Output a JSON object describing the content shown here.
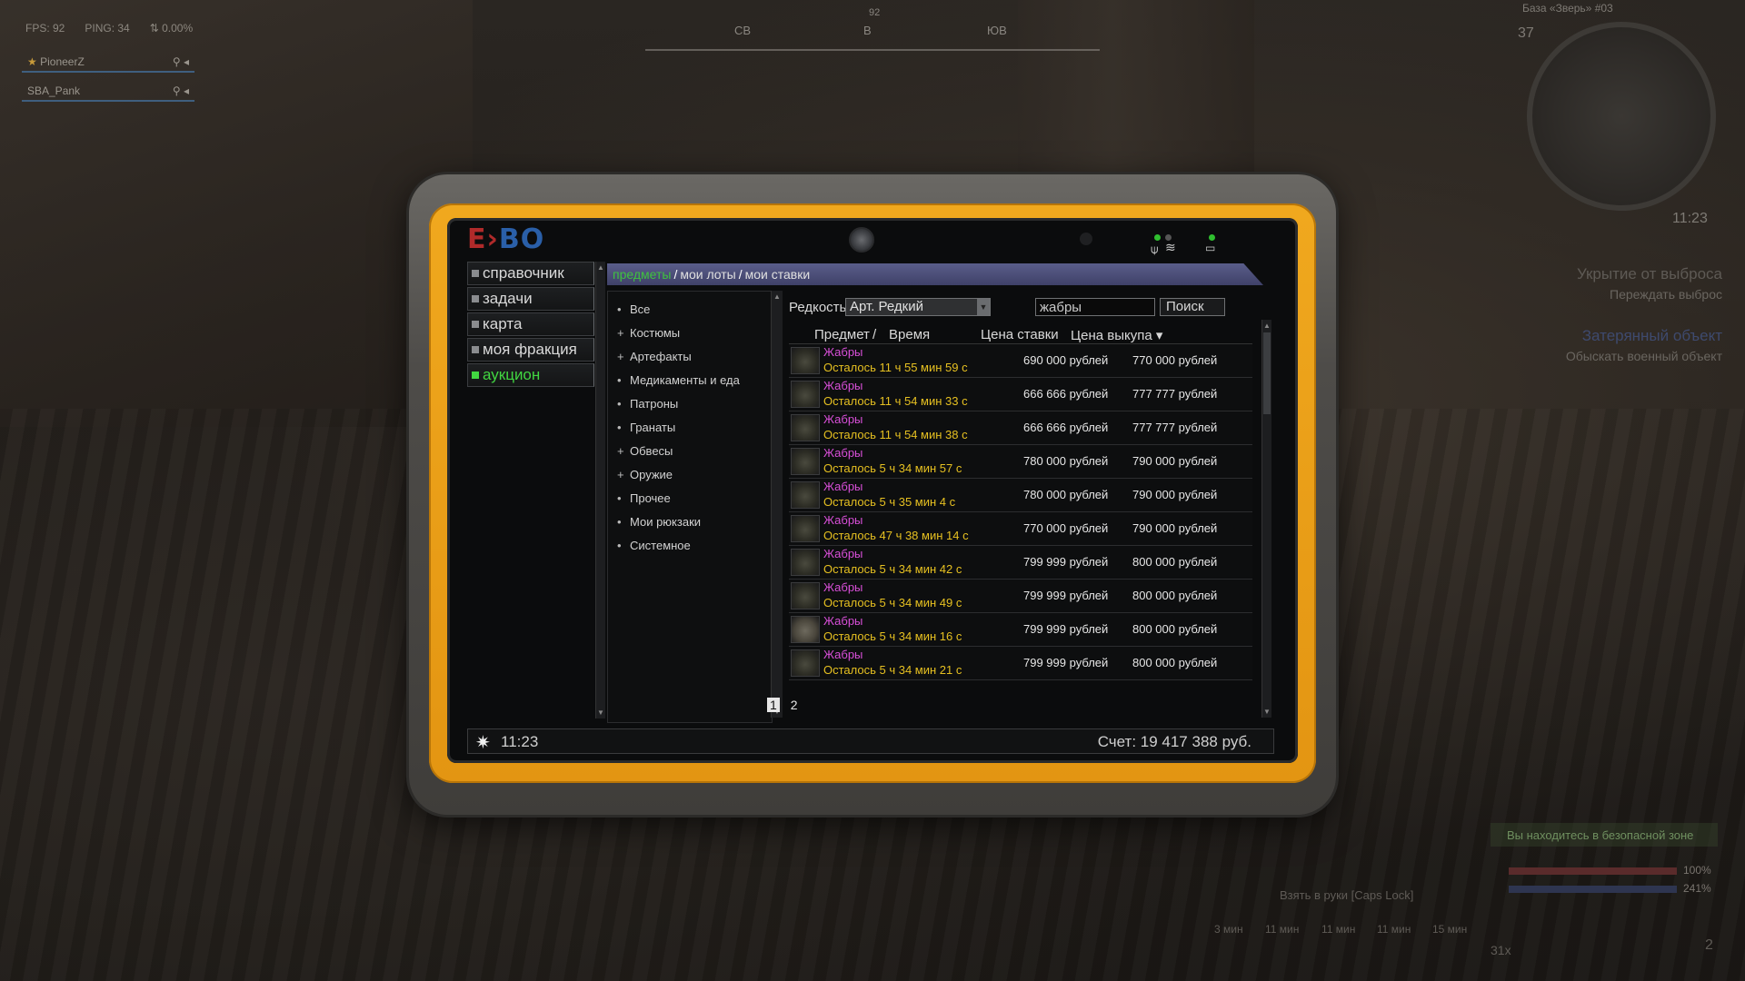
{
  "hud": {
    "fps": "FPS: 92",
    "ping": "PING: 34",
    "loss": "0.00%",
    "party": [
      {
        "name": "PioneerZ"
      },
      {
        "name": "SBA_Pank"
      }
    ],
    "compass": {
      "heading": "92",
      "labels": [
        "СВ",
        "В",
        "ЮВ"
      ]
    },
    "minimap": {
      "title": "База «Зверь» #03",
      "level": "37",
      "time": "11:23"
    },
    "quests": [
      {
        "title": "Укрытие от выброса",
        "sub": "Переждать выброс"
      },
      {
        "title": "Затерянный объект",
        "sub": "Обыскать военный объект"
      }
    ],
    "safe_zone": "Вы находитесь в безопасной зоне",
    "health": "100%",
    "stamina": "241%",
    "pickup": "Взять в руки [Caps Lock]",
    "hotbar": [
      "3 мин",
      "11 мин",
      "11 мин",
      "11 мин",
      "15 мин"
    ],
    "ammo": "31x",
    "count": "2"
  },
  "tablet": {
    "logo_e": "E",
    "logo_bo": "BO",
    "nav": [
      {
        "label": "справочник",
        "active": false
      },
      {
        "label": "задачи",
        "active": false
      },
      {
        "label": "карта",
        "active": false
      },
      {
        "label": "моя фракция",
        "active": false
      },
      {
        "label": "аукцион",
        "active": true
      }
    ],
    "breadcrumb": {
      "current": "предметы",
      "links": [
        "мои лоты",
        "мои ставки"
      ]
    },
    "categories": [
      {
        "bullet": "•",
        "label": "Все"
      },
      {
        "bullet": "+",
        "label": "Костюмы"
      },
      {
        "bullet": "+",
        "label": "Артефакты"
      },
      {
        "bullet": "•",
        "label": "Медикаменты и еда"
      },
      {
        "bullet": "•",
        "label": "Патроны"
      },
      {
        "bullet": "•",
        "label": "Гранаты"
      },
      {
        "bullet": "+",
        "label": "Обвесы"
      },
      {
        "bullet": "+",
        "label": "Оружие"
      },
      {
        "bullet": "•",
        "label": "Прочее"
      },
      {
        "bullet": "•",
        "label": "Мои рюкзаки"
      },
      {
        "bullet": "•",
        "label": "Системное"
      }
    ],
    "filters": {
      "rarity_label": "Редкость",
      "rarity_value": "Арт. Редкий",
      "search_value": "жабры",
      "search_button": "Поиск"
    },
    "table": {
      "headers": {
        "item": "Предмет",
        "sep": "/",
        "time": "Время",
        "bid": "Цена ставки",
        "buyout": "Цена выкупа ▾"
      },
      "rows": [
        {
          "name": "Жабры",
          "time": "Осталось 11 ч 55 мин 59 с",
          "bid": "690 000 рублей",
          "buyout": "770 000 рублей"
        },
        {
          "name": "Жабры",
          "time": "Осталось 11 ч 54 мин 33 с",
          "bid": "666 666 рублей",
          "buyout": "777 777 рублей"
        },
        {
          "name": "Жабры",
          "time": "Осталось 11 ч 54 мин 38 с",
          "bid": "666 666 рублей",
          "buyout": "777 777 рублей"
        },
        {
          "name": "Жабры",
          "time": "Осталось 5 ч 34 мин 57 с",
          "bid": "780 000 рублей",
          "buyout": "790 000 рублей"
        },
        {
          "name": "Жабры",
          "time": "Осталось 5 ч 35 мин 4 с",
          "bid": "780 000 рублей",
          "buyout": "790 000 рублей"
        },
        {
          "name": "Жабры",
          "time": "Осталось 47 ч 38 мин 14 с",
          "bid": "770 000 рублей",
          "buyout": "790 000 рублей"
        },
        {
          "name": "Жабры",
          "time": "Осталось 5 ч 34 мин 42 с",
          "bid": "799 999 рублей",
          "buyout": "800 000 рублей"
        },
        {
          "name": "Жабры",
          "time": "Осталось 5 ч 34 мин 49 с",
          "bid": "799 999 рублей",
          "buyout": "800 000 рублей"
        },
        {
          "name": "Жабры",
          "time": "Осталось 5 ч 34 мин 16 с",
          "bid": "799 999 рублей",
          "buyout": "800 000 рублей"
        },
        {
          "name": "Жабры",
          "time": "Осталось 5 ч 34 мин 21 с",
          "bid": "799 999 рублей",
          "buyout": "800 000 рублей"
        }
      ]
    },
    "pager": {
      "pages": [
        "1",
        "2"
      ],
      "current": "1"
    },
    "status": {
      "time": "11:23",
      "balance": "Счет: 19 417 388 руб."
    }
  }
}
